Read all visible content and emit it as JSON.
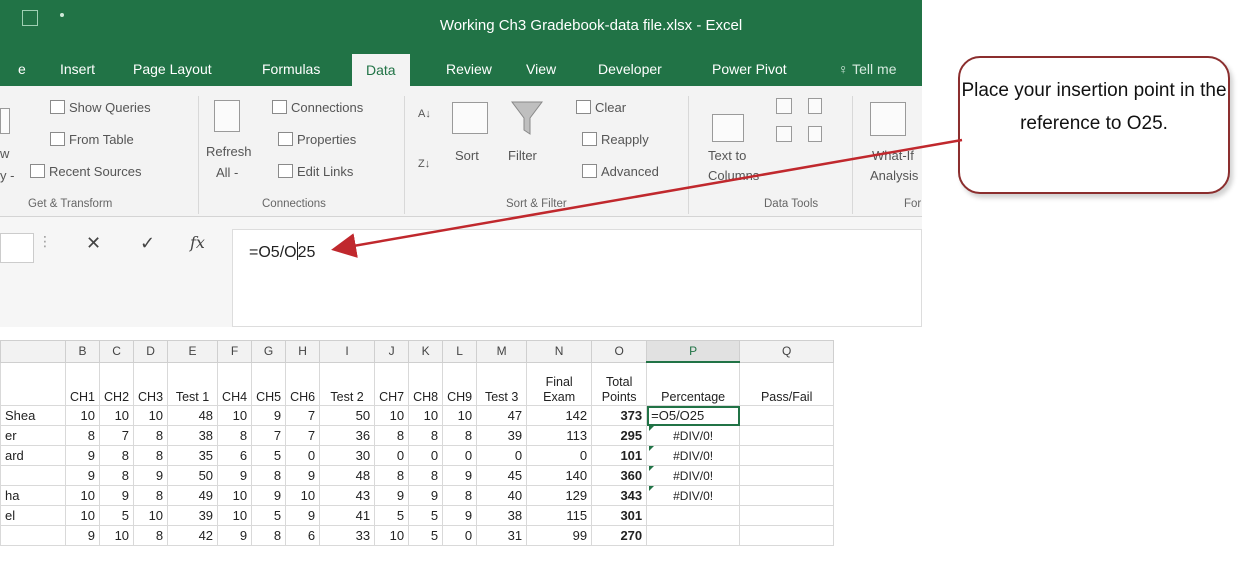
{
  "window": {
    "title": "Working Ch3 Gradebook-data file.xlsx  -  Excel"
  },
  "tabs": [
    {
      "label": "e"
    },
    {
      "label": "Insert"
    },
    {
      "label": "Page Layout"
    },
    {
      "label": "Formulas"
    },
    {
      "label": "Data"
    },
    {
      "label": "Review"
    },
    {
      "label": "View"
    },
    {
      "label": "Developer"
    },
    {
      "label": "Power Pivot"
    },
    {
      "label": "Tell me"
    }
  ],
  "ribbon": {
    "get_transform": {
      "show_queries": "Show Queries",
      "from_table": "From Table",
      "recent_sources": "Recent Sources",
      "partial_w": "w",
      "partial_y": "y -",
      "group": "Get & Transform"
    },
    "connections": {
      "refresh": "Refresh",
      "refresh_all": "All -",
      "connections": "Connections",
      "properties": "Properties",
      "edit_links": "Edit Links",
      "group": "Connections"
    },
    "sort_filter": {
      "sort": "Sort",
      "filter": "Filter",
      "clear": "Clear",
      "reapply": "Reapply",
      "advanced": "Advanced",
      "group": "Sort & Filter"
    },
    "data_tools": {
      "text_to": "Text to",
      "columns": "Columns",
      "group": "Data Tools"
    },
    "forecast": {
      "what_if": "What-If",
      "analysis": "Analysis",
      "group": "For"
    }
  },
  "formula_bar": {
    "cancel": "✕",
    "enter": "✓",
    "fx": "fx",
    "value_before_cursor": "=O5/O",
    "value_after_cursor": "25"
  },
  "columns": [
    "",
    "B",
    "C",
    "D",
    "E",
    "F",
    "G",
    "H",
    "I",
    "J",
    "K",
    "L",
    "M",
    "N",
    "O",
    "P",
    "Q"
  ],
  "headers": [
    "",
    "CH1",
    "CH2",
    "CH3",
    "Test 1",
    "CH4",
    "CH5",
    "CH6",
    "Test 2",
    "CH7",
    "CH8",
    "CH9",
    "Test 3",
    "Final Exam",
    "Total Points",
    "Percentage",
    "Pass/Fail"
  ],
  "rows": [
    {
      "name": "Shea",
      "vals": [
        "10",
        "10",
        "10",
        "48",
        "10",
        "9",
        "7",
        "50",
        "10",
        "10",
        "10",
        "47",
        "142"
      ],
      "total": "373",
      "pct": "=O5/O25"
    },
    {
      "name": "er",
      "vals": [
        "8",
        "7",
        "8",
        "38",
        "8",
        "7",
        "7",
        "36",
        "8",
        "8",
        "8",
        "39",
        "113"
      ],
      "total": "295",
      "pct": "#DIV/0!"
    },
    {
      "name": "ard",
      "vals": [
        "9",
        "8",
        "8",
        "35",
        "6",
        "5",
        "0",
        "30",
        "0",
        "0",
        "0",
        "0",
        "0"
      ],
      "total": "101",
      "pct": "#DIV/0!"
    },
    {
      "name": "",
      "vals": [
        "9",
        "8",
        "9",
        "50",
        "9",
        "8",
        "9",
        "48",
        "8",
        "8",
        "9",
        "45",
        "140"
      ],
      "total": "360",
      "pct": "#DIV/0!"
    },
    {
      "name": "ha",
      "vals": [
        "10",
        "9",
        "8",
        "49",
        "10",
        "9",
        "10",
        "43",
        "9",
        "9",
        "8",
        "40",
        "129"
      ],
      "total": "343",
      "pct": "#DIV/0!"
    },
    {
      "name": "el",
      "vals": [
        "10",
        "5",
        "10",
        "39",
        "10",
        "5",
        "9",
        "41",
        "5",
        "5",
        "9",
        "38",
        "115"
      ],
      "total": "301",
      "pct": ""
    },
    {
      "name": "",
      "vals": [
        "9",
        "10",
        "8",
        "42",
        "9",
        "8",
        "6",
        "33",
        "10",
        "5",
        "0",
        "31",
        "99"
      ],
      "total": "270",
      "pct": ""
    }
  ],
  "callout": {
    "text": "Place your insertion point in the reference to O25."
  },
  "colors": {
    "excel_green": "#217346",
    "callout_border": "#8b2e2e",
    "arrow": "#c0282d"
  }
}
